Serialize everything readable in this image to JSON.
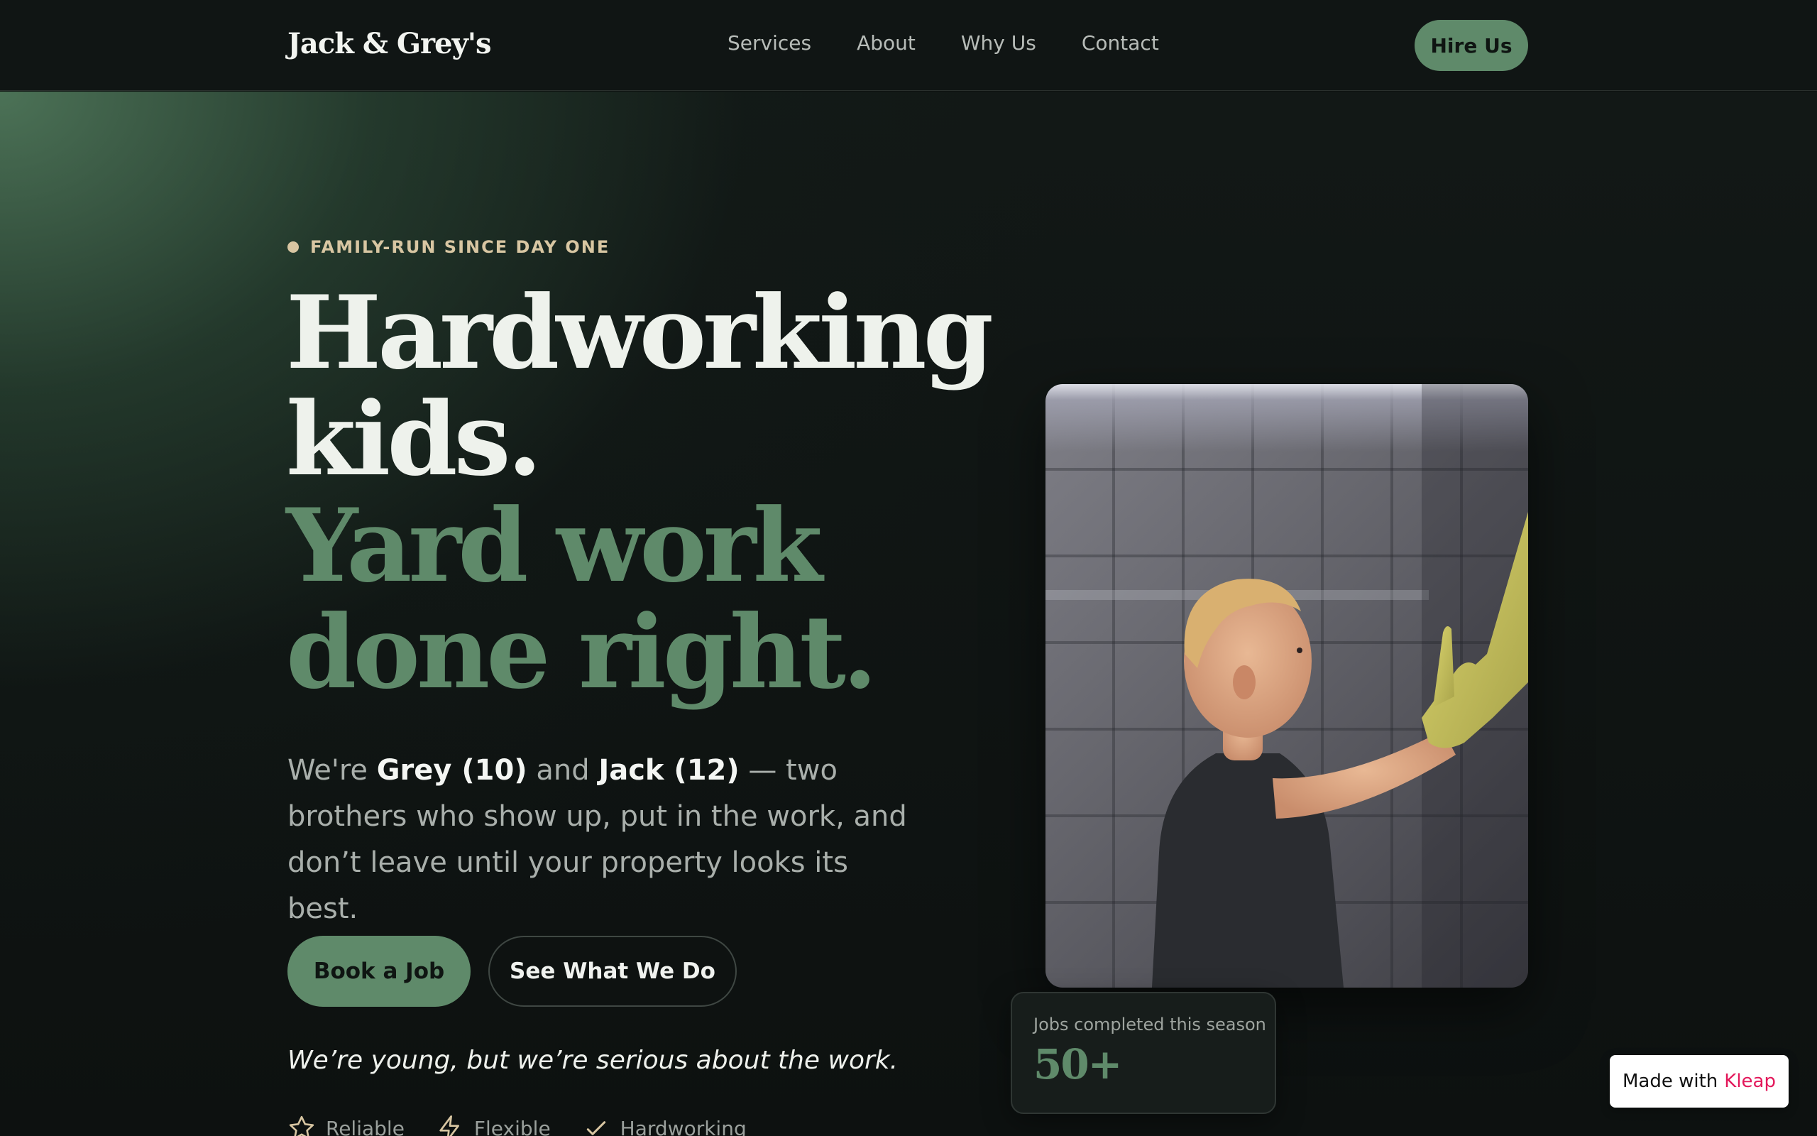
{
  "nav": {
    "brand": "Jack & Grey's",
    "links": [
      "Services",
      "About",
      "Why Us",
      "Contact"
    ],
    "cta": "Hire Us"
  },
  "hero": {
    "eyebrow": "FAMILY-RUN SINCE DAY ONE",
    "headline_lines": [
      "Hardworking",
      "kids.",
      "Yard work",
      "done right."
    ],
    "intro": {
      "p1": "We're ",
      "name1": "Grey (10)",
      "p2": " and ",
      "name2": "Jack (12)",
      "p3": " — two brothers who show up, put in the work, and don’t leave until your property looks its best."
    },
    "primary_button": "Book a Job",
    "secondary_button": "See What We Do",
    "tagline": "We’re young, but we’re serious about the work.",
    "traits": [
      {
        "label": "Reliable",
        "icon": "star-icon"
      },
      {
        "label": "Flexible",
        "icon": "lightning-icon"
      },
      {
        "label": "Hardworking",
        "icon": "check-icon"
      }
    ]
  },
  "stat": {
    "label": "Jobs completed this season",
    "value": "50+"
  },
  "badge": {
    "prefix": "Made with",
    "brand": "Kleap"
  },
  "colors": {
    "accent": "#5f8a6a",
    "eyebrow": "#d8c6a2",
    "background": "#0d1210",
    "badge_brand": "#e3185b"
  }
}
